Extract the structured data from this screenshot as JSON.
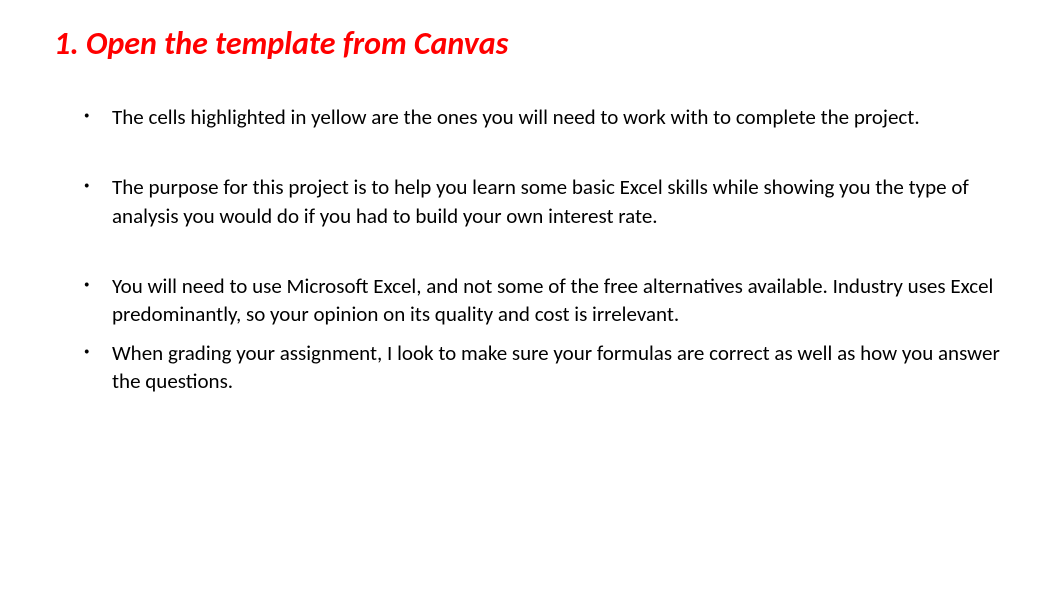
{
  "heading": "1. Open the template from Canvas",
  "bullets": [
    "The cells highlighted in yellow are the ones you will need to work with to complete the project.",
    "The purpose for this project is to help you learn some basic Excel skills while showing you the type of analysis you would do if you had to build your own interest rate.",
    "You will need to use Microsoft Excel, and not some of the free alternatives available.  Industry uses Excel predominantly, so your opinion on its quality and cost is irrelevant.",
    "When grading your assignment, I look to make sure your formulas are correct as well as how you answer the questions."
  ]
}
